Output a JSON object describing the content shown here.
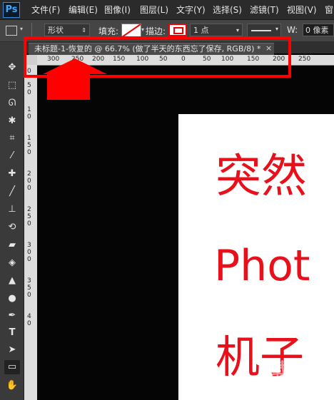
{
  "app": {
    "logo": "Ps"
  },
  "menubar": {
    "items": [
      "文件(F)",
      "编辑(E)",
      "图像(I)",
      "图层(L)",
      "文字(Y)",
      "选择(S)",
      "滤镜(T)",
      "视图(V)",
      "窗"
    ]
  },
  "options": {
    "shape_mode": "形状",
    "fill_label": "填充:",
    "stroke_label": "描边:",
    "stroke_size": "1 点",
    "width_label": "W:",
    "width_value": "0 像素"
  },
  "document_tab": {
    "title": "未标题-1-恢复的 @ 66.7% (做了半天的东西忘了保存, RGB/8) *",
    "close": "×"
  },
  "ruler": {
    "horizontal_ticks": [
      "300",
      "250",
      "200",
      "150",
      "100",
      "50",
      "0",
      "50",
      "100",
      "150",
      "200",
      "250"
    ],
    "vertical_ticks": [
      "0",
      "5",
      "0",
      "1",
      "0",
      "1",
      "5",
      "0",
      "2",
      "0",
      "0",
      "2",
      "5",
      "0",
      "3",
      "0",
      "0",
      "3",
      "5",
      "0",
      "4",
      "0"
    ]
  },
  "canvas_text": {
    "line1": "突然",
    "line2": "Phot",
    "line3": "机子"
  },
  "tools": [
    "move-tool",
    "marquee-tool",
    "lasso-tool",
    "magic-wand-tool",
    "crop-tool",
    "eyedropper-tool",
    "healing-brush-tool",
    "brush-tool",
    "clone-stamp-tool",
    "history-brush-tool",
    "eraser-tool",
    "paint-bucket-tool",
    "blur-tool",
    "dodge-tool",
    "pen-tool",
    "type-tool",
    "path-selection-tool",
    "rectangle-tool",
    "hand-tool"
  ],
  "watermark": {
    "text": "下载吧",
    "sub": "www.xiazaiba.com"
  },
  "colors": {
    "accent_red": "#ff0000",
    "text_red": "#e8101a",
    "ps_blue": "#3fa9f5"
  }
}
